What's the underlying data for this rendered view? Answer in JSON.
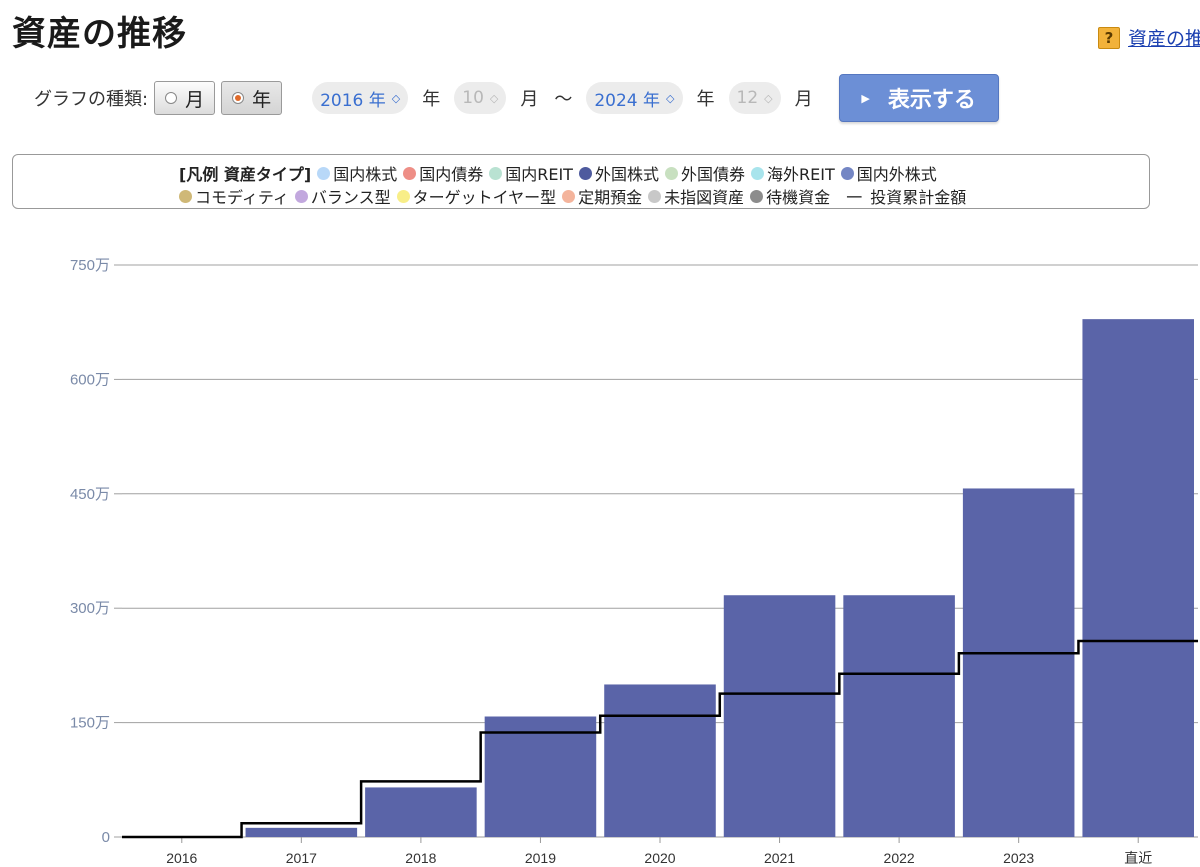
{
  "page": {
    "title": "資産の推移",
    "help_link": "資産の推移"
  },
  "controls": {
    "graph_type_label": "グラフの種類:",
    "options": [
      "月",
      "年"
    ],
    "selected": "年",
    "from_year": "2016 年",
    "from_month": "10",
    "to_year": "2024 年",
    "to_month": "12",
    "year_unit": "年",
    "month_unit": "月",
    "tilde": "〜",
    "show_button": "表示する"
  },
  "legend": {
    "title": "[凡例 資産タイプ]",
    "items": [
      {
        "label": "国内株式",
        "color": "#b8d8f8"
      },
      {
        "label": "国内債券",
        "color": "#ee8e86"
      },
      {
        "label": "国内REIT",
        "color": "#b9e2d2"
      },
      {
        "label": "外国株式",
        "color": "#4e5a9e"
      },
      {
        "label": "外国債券",
        "color": "#c8e0c0"
      },
      {
        "label": "海外REIT",
        "color": "#a8e4ec"
      },
      {
        "label": "国内外株式",
        "color": "#7486c4"
      },
      {
        "label": "コモディティ",
        "color": "#cfb877"
      },
      {
        "label": "バランス型",
        "color": "#c2a8de"
      },
      {
        "label": "ターゲットイヤー型",
        "color": "#f8ee88"
      },
      {
        "label": "定期預金",
        "color": "#f4b49c"
      },
      {
        "label": "未指図資産",
        "color": "#c8c8c8"
      },
      {
        "label": "待機資金",
        "color": "#8c8c8c"
      }
    ],
    "line_label": "投資累計金額",
    "line_symbol": "一"
  },
  "chart_data": {
    "type": "bar",
    "categories": [
      "2016",
      "2017",
      "2018",
      "2019",
      "2020",
      "2021",
      "2022",
      "2023",
      "直近"
    ],
    "y_ticks": [
      "0",
      "150万",
      "300万",
      "450万",
      "600万",
      "750万"
    ],
    "ylim": [
      0,
      7500000
    ],
    "bar_color": "#5a64a8",
    "series": [
      {
        "values": [
          0,
          120000,
          650000,
          1580000,
          2000000,
          3170000,
          3170000,
          4570000,
          6790000
        ]
      }
    ],
    "line_series": {
      "values": [
        0,
        180000,
        730000,
        1370000,
        1590000,
        1880000,
        2140000,
        2410000,
        2570000
      ]
    },
    "grid": true
  }
}
